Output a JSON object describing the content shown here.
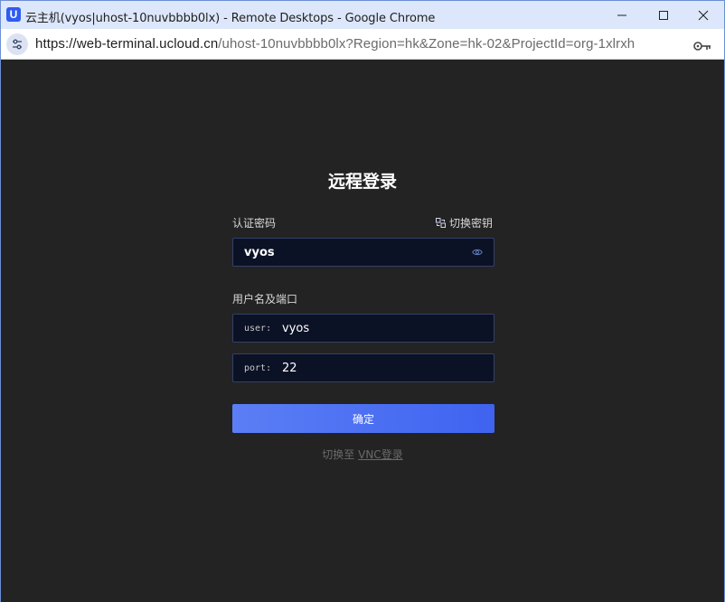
{
  "window": {
    "title": "云主机(vyos|uhost-10nuvbbbb0lx) - Remote Desktops - Google Chrome",
    "app_icon_letter": "U"
  },
  "address_bar": {
    "url_scheme_host": "https://web-terminal.ucloud.cn",
    "url_path_query": "/uhost-10nuvbbbb0lx?Region=hk&Zone=hk-02&ProjectId=org-1xlrxh"
  },
  "login": {
    "title": "远程登录",
    "auth_label": "认证密码",
    "switch_key_label": "切换密钥",
    "password_value": "vyos",
    "user_port_label": "用户名及端口",
    "user_prefix": "user:",
    "user_value": "vyos",
    "port_prefix": "port:",
    "port_value": "22",
    "confirm_label": "确定",
    "switch_vnc_prefix": "切换至",
    "switch_vnc_link": "VNC登录"
  },
  "colors": {
    "background": "#232324",
    "input_bg": "#0c1226",
    "input_border": "#344065",
    "button_start": "#5b7ef5",
    "button_end": "#3f63f0",
    "titlebar": "#dde7fb"
  },
  "icons": {
    "site_info": "tune-icon",
    "key": "key-icon",
    "switch_key": "key-swap-icon",
    "password_toggle": "eye-icon"
  }
}
